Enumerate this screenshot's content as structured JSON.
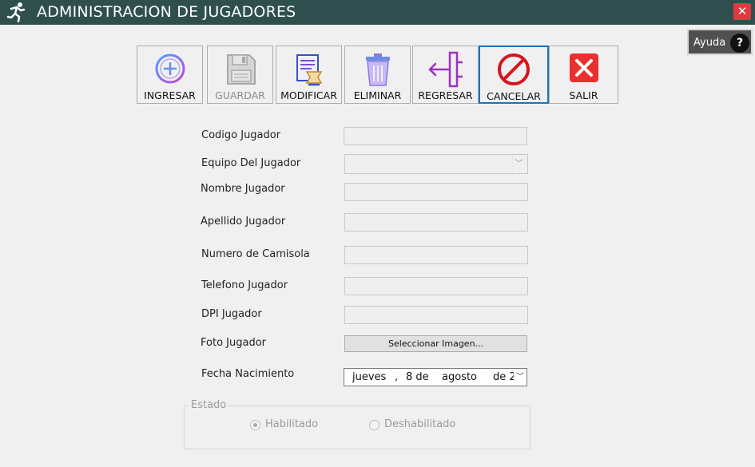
{
  "window": {
    "title": "ADMINISTRACION DE JUGADORES",
    "close_label": "✕",
    "app_icon": "running-man-icon"
  },
  "help": {
    "label": "Ayuda",
    "icon_glyph": "?"
  },
  "toolbar": {
    "ingresar": "INGRESAR",
    "guardar": "GUARDAR",
    "modificar": "MODIFICAR",
    "eliminar": "ELIMINAR",
    "regresar": "REGRESAR",
    "cancelar": "CANCELAR",
    "salir": "SALIR"
  },
  "form": {
    "codigo_label": "Codigo Jugador",
    "codigo_value": "",
    "equipo_label": "Equipo Del Jugador",
    "equipo_value": "",
    "nombre_label": "Nombre Jugador",
    "nombre_value": "",
    "apellido_label": "Apellido Jugador",
    "apellido_value": "",
    "camisola_label": "Numero de Camisola",
    "camisola_value": "",
    "telefono_label": "Telefono Jugador",
    "telefono_value": "",
    "dpi_label": "DPI Jugador",
    "dpi_value": "",
    "foto_label": "Foto Jugador",
    "foto_button": "Seleccionar Imagen...",
    "fecha_label": "Fecha Nacimiento",
    "fecha": {
      "weekday": "jueves",
      "sep": ",",
      "day": "8 de",
      "month": "agosto",
      "year_partial": "de 2"
    }
  },
  "estado": {
    "legend": "Estado",
    "habilitado": "Habilitado",
    "deshabilitado": "Deshabilitado",
    "selected": "Habilitado"
  },
  "colors": {
    "titlebar": "#2f4f4f",
    "close": "#e0393e",
    "active_border": "#1874c4",
    "cancel_red": "#d6141e"
  }
}
